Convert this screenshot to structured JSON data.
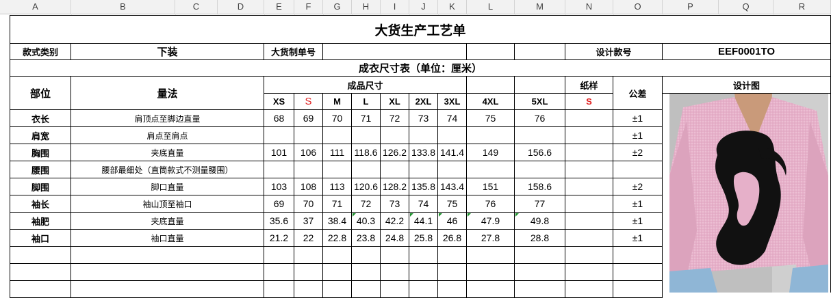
{
  "columns": [
    "A",
    "B",
    "C",
    "D",
    "E",
    "F",
    "G",
    "H",
    "I",
    "J",
    "K",
    "L",
    "M",
    "N",
    "O",
    "P",
    "Q",
    "R"
  ],
  "title": "大货生产工艺单",
  "info_row": {
    "style_type_label": "款式类别",
    "style_type_value": "下装",
    "order_no_label": "大货制单号",
    "design_no_label": "设计款号",
    "design_no_value": "EEF0001TO"
  },
  "size_table_title": "成衣尺寸表（单位：厘米）",
  "headers": {
    "part": "部位",
    "method": "量法",
    "finished_size": "成品尺寸",
    "pattern": "纸样",
    "tolerance": "公差",
    "design": "设计图"
  },
  "sizes": [
    "XS",
    "S",
    "M",
    "L",
    "XL",
    "2XL",
    "3XL",
    "4XL",
    "5XL"
  ],
  "pattern_size": "S",
  "rows": [
    {
      "part": "衣长",
      "method": "肩顶点至脚边直量",
      "values": [
        "68",
        "69",
        "70",
        "71",
        "72",
        "73",
        "74",
        "75",
        "76"
      ],
      "tolerance": "±1"
    },
    {
      "part": "肩宽",
      "method": "肩点至肩点",
      "values": [
        "",
        "",
        "",
        "",
        "",
        "",
        "",
        "",
        ""
      ],
      "tolerance": "±1"
    },
    {
      "part": "胸围",
      "method": "夹底直量",
      "values": [
        "101",
        "106",
        "111",
        "118.6",
        "126.2",
        "133.8",
        "141.4",
        "149",
        "156.6"
      ],
      "tolerance": "±2"
    },
    {
      "part": "腰围",
      "method": "腰部最细处（直筒款式不测量腰围）",
      "values": [
        "",
        "",
        "",
        "",
        "",
        "",
        "",
        "",
        ""
      ],
      "tolerance": ""
    },
    {
      "part": "脚围",
      "method": "脚口直量",
      "values": [
        "103",
        "108",
        "113",
        "120.6",
        "128.2",
        "135.8",
        "143.4",
        "151",
        "158.6"
      ],
      "tolerance": "±2"
    },
    {
      "part": "袖长",
      "method": "袖山顶至袖口",
      "values": [
        "69",
        "70",
        "71",
        "72",
        "73",
        "74",
        "75",
        "76",
        "77"
      ],
      "tolerance": "±1"
    },
    {
      "part": "袖肥",
      "method": "夹底直量",
      "values": [
        "35.6",
        "37",
        "38.4",
        "40.3",
        "42.2",
        "44.1",
        "46",
        "47.9",
        "49.8"
      ],
      "tolerance": "±1"
    },
    {
      "part": "袖口",
      "method": "袖口直量",
      "values": [
        "21.2",
        "22",
        "22.8",
        "23.8",
        "24.8",
        "25.8",
        "26.8",
        "27.8",
        "28.8"
      ],
      "tolerance": "±1"
    }
  ],
  "colors": {
    "shirt_pink": "#e8b4cc",
    "print_black": "#111111",
    "red_text": "#e02020",
    "marker_green": "#1a8f2a"
  }
}
